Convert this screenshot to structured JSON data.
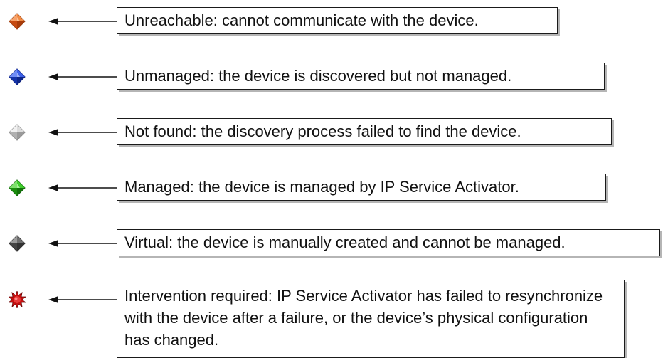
{
  "legend": {
    "items": [
      {
        "status": "Unreachable",
        "icon": "orange-diamond-icon",
        "color": "#e8601c",
        "description": "Unreachable: cannot communicate with the device."
      },
      {
        "status": "Unmanaged",
        "icon": "blue-diamond-icon",
        "color": "#1a3fcf",
        "description": "Unmanaged: the device is discovered but not managed."
      },
      {
        "status": "Not found",
        "icon": "light-gray-diamond-icon",
        "color": "#c8c8c8",
        "description": "Not found: the discovery process failed to find the device."
      },
      {
        "status": "Managed",
        "icon": "green-diamond-icon",
        "color": "#22b014",
        "description": "Managed: the device is managed by IP Service Activator."
      },
      {
        "status": "Virtual",
        "icon": "dark-gray-diamond-icon",
        "color": "#555555",
        "description": "Virtual: the device is manually created and cannot be managed."
      },
      {
        "status": "Intervention required",
        "icon": "red-burst-icon",
        "color": "#c81010",
        "description": "Intervention required: IP Service Activator has failed to resynchronize with the device after a failure, or the device’s physical configuration has changed."
      }
    ]
  }
}
